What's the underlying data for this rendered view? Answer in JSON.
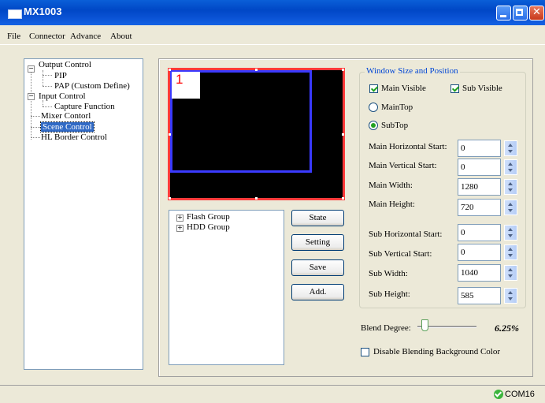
{
  "window": {
    "title": "MX1003"
  },
  "menu": [
    "File",
    "Connector",
    "Advance",
    "About"
  ],
  "tree": {
    "output_control": "Output Control",
    "pip": "PIP",
    "pap": "PAP (Custom Define)",
    "input_control": "Input Control",
    "capture_function": "Capture Function",
    "mixer_control": "Mixer Contorl",
    "scene_control": "Scene Control",
    "hl_border_control": "HL Border Control"
  },
  "preview": {
    "main_label": "1"
  },
  "groups": {
    "flash": "Flash Group",
    "hdd": "HDD Group"
  },
  "buttons": {
    "state": "State",
    "setting": "Setting",
    "save": "Save",
    "add": "Add."
  },
  "wsp": {
    "legend": "Window Size and Position",
    "main_visible": "Main Visible",
    "sub_visible": "Sub Visible",
    "main_top": "MainTop",
    "sub_top": "SubTop",
    "main_h_start": {
      "label": "Main Horizontal Start:",
      "value": "0"
    },
    "main_v_start": {
      "label": "Main Vertical Start:",
      "value": "0"
    },
    "main_width": {
      "label": "Main Width:",
      "value": "1280"
    },
    "main_height": {
      "label": "Main Height:",
      "value": "720"
    },
    "sub_h_start": {
      "label": "Sub Horizontal Start:",
      "value": "0"
    },
    "sub_v_start": {
      "label": "Sub Vertical Start:",
      "value": "0"
    },
    "sub_width": {
      "label": "Sub Width:",
      "value": "1040"
    },
    "sub_height": {
      "label": "Sub Height:",
      "value": "585"
    }
  },
  "blend": {
    "label": "Blend Degree:",
    "value": "6.25%",
    "fraction": 0.0625
  },
  "disable_blend_label": "Disable Blending Background Color",
  "status": {
    "port": "COM16"
  },
  "colors": {
    "title_blue": "#0047c6",
    "main_border": "#3a3aff",
    "sub_border": "#ff3a3a",
    "legend_blue": "#0046d5"
  }
}
